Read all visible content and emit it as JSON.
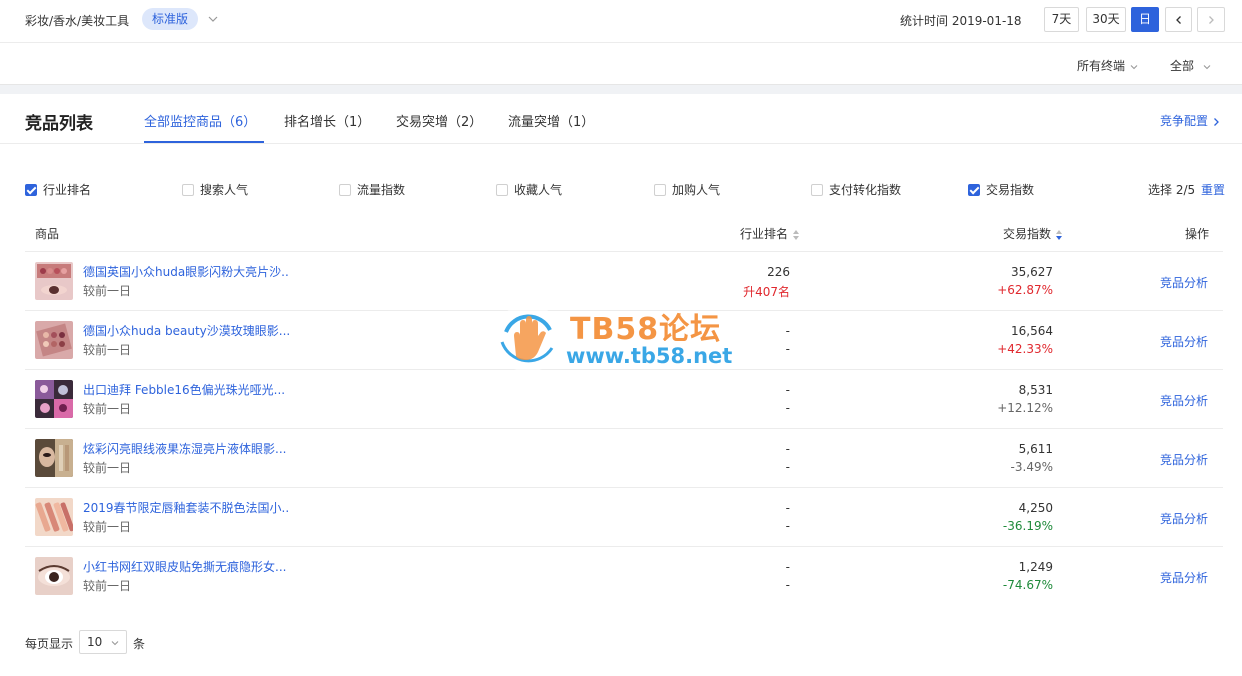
{
  "header": {
    "category": "彩妆/香水/美妆工具",
    "edition": "标准版",
    "stat_time_label": "统计时间 2019-01-18",
    "range_buttons": [
      "7天",
      "30天",
      "日"
    ],
    "active_range": "日"
  },
  "filters": {
    "terminal": "所有终端",
    "scope": "全部"
  },
  "section": {
    "title": "竞品列表",
    "tabs": [
      {
        "label": "全部监控商品（6）",
        "active": true
      },
      {
        "label": "排名增长（1）",
        "active": false
      },
      {
        "label": "交易突增（2）",
        "active": false
      },
      {
        "label": "流量突增（1）",
        "active": false
      }
    ],
    "config_link": "竞争配置"
  },
  "metrics": {
    "options": [
      {
        "label": "行业排名",
        "checked": true
      },
      {
        "label": "搜索人气",
        "checked": false
      },
      {
        "label": "流量指数",
        "checked": false
      },
      {
        "label": "收藏人气",
        "checked": false
      },
      {
        "label": "加购人气",
        "checked": false
      },
      {
        "label": "支付转化指数",
        "checked": false
      },
      {
        "label": "交易指数",
        "checked": true
      }
    ],
    "selected_count": "选择 2/5",
    "reset_label": "重置"
  },
  "table": {
    "columns": [
      "商品",
      "行业排名",
      "交易指数",
      "操作"
    ],
    "rows": [
      {
        "name": "德国英国小众huda眼影闪粉大亮片沙..",
        "sub": "较前一日",
        "rank": "226",
        "rank_change": "升407名",
        "index": "35,627",
        "change": "+62.87%",
        "change_color": "red",
        "action": "竞品分析"
      },
      {
        "name": "德国小众huda beauty沙漠玫瑰眼影...",
        "sub": "较前一日",
        "rank": "-",
        "rank_change": "-",
        "index": "16,564",
        "change": "+42.33%",
        "change_color": "red",
        "action": "竞品分析"
      },
      {
        "name": "出口迪拜 Febble16色偏光珠光哑光...",
        "sub": "较前一日",
        "rank": "-",
        "rank_change": "-",
        "index": "8,531",
        "change": "+12.12%",
        "change_color": "gray",
        "action": "竞品分析"
      },
      {
        "name": "炫彩闪亮眼线液果冻湿亮片液体眼影...",
        "sub": "较前一日",
        "rank": "-",
        "rank_change": "-",
        "index": "5,611",
        "change": "-3.49%",
        "change_color": "gray",
        "action": "竞品分析"
      },
      {
        "name": "2019春节限定唇釉套装不脱色法国小..",
        "sub": "较前一日",
        "rank": "-",
        "rank_change": "-",
        "index": "4,250",
        "change": "-36.19%",
        "change_color": "green",
        "action": "竞品分析"
      },
      {
        "name": "小红书网红双眼皮贴免撕无痕隐形女...",
        "sub": "较前一日",
        "rank": "-",
        "rank_change": "-",
        "index": "1,249",
        "change": "-74.67%",
        "change_color": "green",
        "action": "竞品分析"
      }
    ]
  },
  "pagination": {
    "per_page_label": "每页显示",
    "per_page_value": "10",
    "unit": "条"
  },
  "watermark": {
    "line1": "TB58论坛",
    "line2": "www.tb58.net"
  }
}
